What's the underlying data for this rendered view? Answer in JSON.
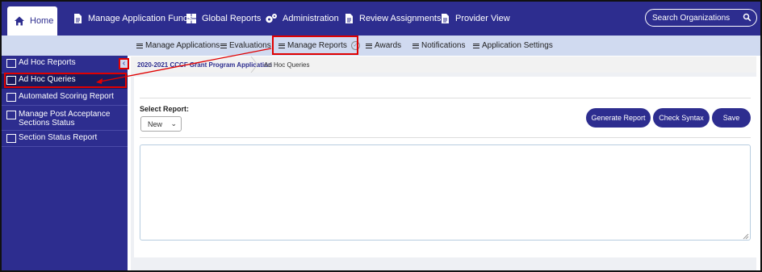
{
  "topnav": {
    "items": [
      {
        "label": "Home",
        "icon": "home-icon"
      },
      {
        "label": "Manage Application Funds",
        "icon": "document-icon"
      },
      {
        "label": "Global Reports",
        "icon": "grid-icon"
      },
      {
        "label": "Administration",
        "icon": "gears-icon"
      },
      {
        "label": "Review Assignments",
        "icon": "document-icon"
      },
      {
        "label": "Provider View",
        "icon": "document-icon"
      }
    ],
    "search_placeholder": "Search Organizations"
  },
  "subnav": {
    "items": [
      {
        "label": "Manage Applications"
      },
      {
        "label": "Evaluations"
      },
      {
        "label": "Manage Reports"
      },
      {
        "label": "Awards"
      },
      {
        "label": "Notifications"
      },
      {
        "label": "Application Settings"
      }
    ]
  },
  "sidebar": {
    "items": [
      {
        "label": "Ad Hoc Reports"
      },
      {
        "label": "Ad Hoc Queries"
      },
      {
        "label": "Automated Scoring Report"
      },
      {
        "label": "Manage Post Acceptance Sections Status"
      },
      {
        "label": "Section Status Report"
      }
    ],
    "collapse_glyph": "‹"
  },
  "breadcrumb": {
    "program": "2020-2021 CCCF Grant Program Application",
    "current": "Ad Hoc Queries"
  },
  "main": {
    "select_label": "Select Report:",
    "select_value": "New",
    "buttons": {
      "generate": "Generate Report",
      "syntax": "Check Syntax",
      "save": "Save"
    }
  },
  "colors": {
    "brand": "#2d2d8f",
    "subnav": "#d0daf0",
    "annotation": "#e00000"
  }
}
